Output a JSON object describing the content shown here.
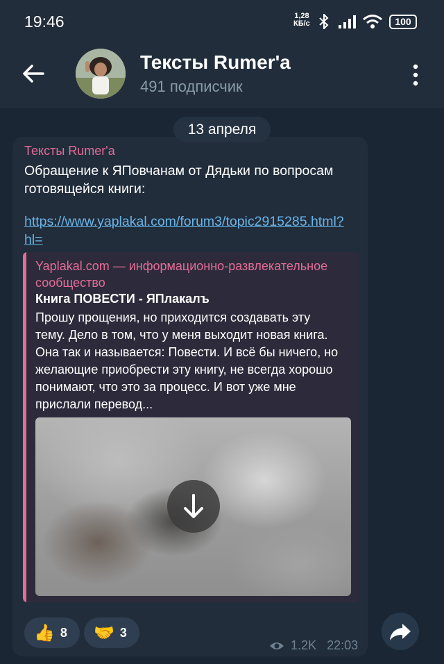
{
  "status_bar": {
    "time": "19:46",
    "net_speed_value": "1,28",
    "net_speed_unit": "КБ/с",
    "battery": "100",
    "icons": [
      "bluetooth-icon",
      "signal-icon",
      "wifi-icon",
      "battery-icon"
    ]
  },
  "header": {
    "title": "Тексты Rumer'a",
    "subtitle": "491 подписчик",
    "back_icon": "arrow-left-icon",
    "menu_icon": "more-vertical-icon"
  },
  "date_separator": "13 апреля",
  "message": {
    "author": "Тексты Rumer'a",
    "text": "Обращение к ЯПовчанам от Дядьки по вопросам готовящейся книги:",
    "link": "https://www.yaplakal.com/forum3/topic2915285.html?hl=",
    "preview": {
      "site": "Yaplakal.com — информационно-развлекательное сообщество",
      "title": "Книга ПОВЕСТИ - ЯПлакалъ",
      "description": "Прошу прощения, но приходится создавать эту тему.  Дело в том, что у меня выходит новая книга. Она так и называется: Повести. И всё бы ничего, но желающие приобрести эту книгу, не всегда хорошо понимают, что это за процесс. И вот уже мне прислали перевод..."
    },
    "reactions": [
      {
        "emoji": "👍",
        "count": "8"
      },
      {
        "emoji": "🤝",
        "count": "3"
      }
    ],
    "views": "1.2K",
    "time": "22:03"
  },
  "colors": {
    "background": "#1a2633",
    "header": "#212d3b",
    "accent_pink": "#e46c97",
    "link_blue": "#6ab4e8"
  }
}
